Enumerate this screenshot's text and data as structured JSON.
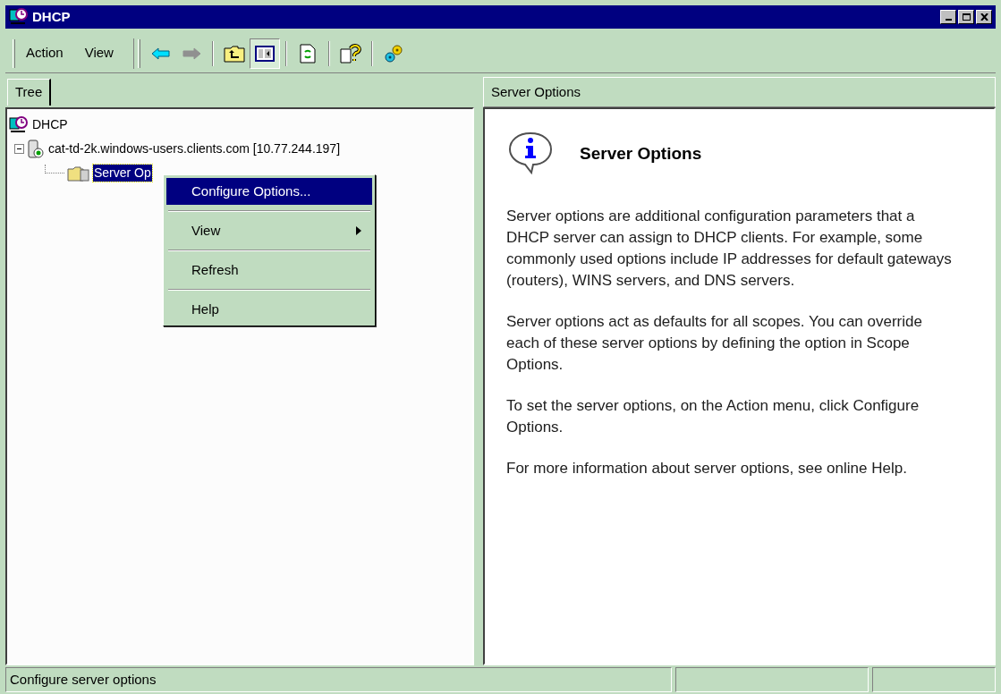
{
  "window": {
    "title": "DHCP"
  },
  "menu_bar": [
    {
      "label": "Action"
    },
    {
      "label": "View"
    }
  ],
  "toolbar": [
    {
      "kind": "back",
      "disabled": false
    },
    {
      "kind": "forward",
      "disabled": true
    },
    {
      "kind": "sep"
    },
    {
      "kind": "up",
      "pressed": false
    },
    {
      "kind": "tree",
      "pressed": true
    },
    {
      "kind": "sep"
    },
    {
      "kind": "refresh",
      "pressed": false
    },
    {
      "kind": "sep"
    },
    {
      "kind": "help",
      "pressed": false
    },
    {
      "kind": "sep"
    },
    {
      "kind": "wizard",
      "pressed": false
    }
  ],
  "tabs": [
    {
      "label": "Tree",
      "selected": true
    }
  ],
  "tree": [
    {
      "label": "DHCP",
      "kind": "dhcp",
      "selected": false,
      "children": [
        {
          "label": "cat-td-2k.windows-users.clients.com [10.77.244.197]",
          "kind": "server",
          "selected": false,
          "expanded": true,
          "children": [
            {
              "label": "Server Op",
              "kind": "options",
              "selected": true
            }
          ]
        }
      ]
    }
  ],
  "context_menu": [
    {
      "label": "Configure Options...",
      "selected": true,
      "submenu": false
    },
    {
      "label": "View",
      "selected": false,
      "submenu": true
    },
    {
      "label": "Refresh",
      "selected": false,
      "submenu": false
    },
    {
      "label": "Help",
      "selected": false,
      "submenu": false
    }
  ],
  "details": {
    "header": "Server Options",
    "title": "Server Options",
    "paragraphs": [
      "Server options are additional configuration parameters that a DHCP server can assign to DHCP clients. For example, some commonly used options include IP addresses for default gateways (routers), WINS servers, and DNS servers.",
      "Server options act as defaults for all scopes.  You can override each of these server options by defining the option in Scope Options.",
      "To set the server options, on the Action menu, click Configure Options.",
      "For more information about server options, see online Help."
    ]
  },
  "status_bar": {
    "text": "Configure server options"
  }
}
